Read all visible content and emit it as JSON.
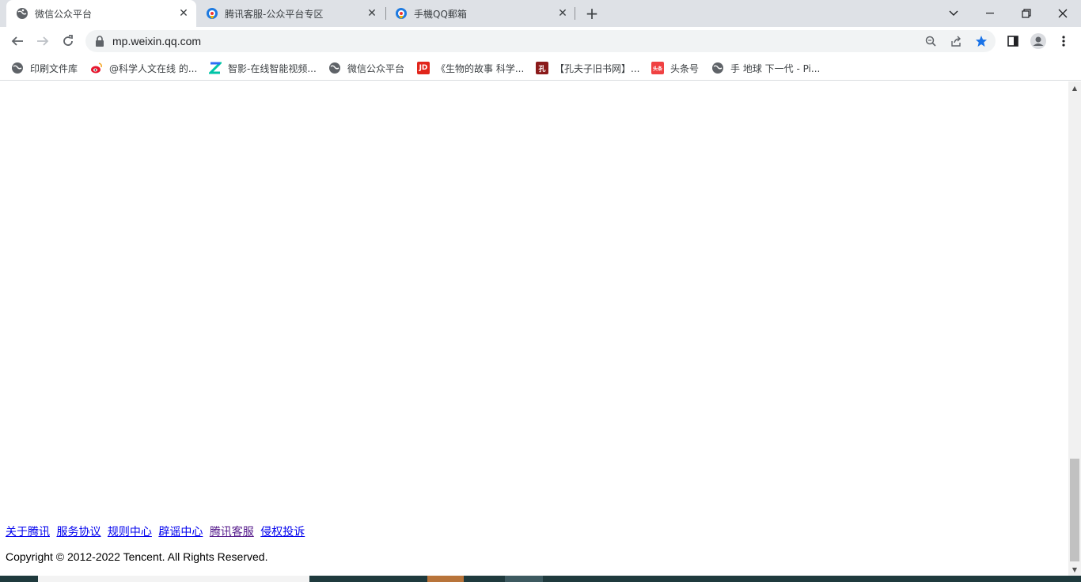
{
  "browser": {
    "tabs": [
      {
        "title": "微信公众平台",
        "favicon": "globe-icon",
        "active": true
      },
      {
        "title": "腾讯客服-公众平台专区",
        "favicon": "tencent-cs-icon",
        "active": false
      },
      {
        "title": "手機QQ郵箱",
        "favicon": "tencent-cs-icon",
        "active": false
      }
    ],
    "new_tab": "+",
    "window_controls": {
      "tab_search": "⌄",
      "minimize": "—",
      "restore": "❐",
      "close": "✕"
    },
    "nav": {
      "back": "←",
      "forward": "→",
      "reload": "↻"
    },
    "url": "mp.weixin.qq.com",
    "omnibox_icons": {
      "zoom": "🔍",
      "share": "⇪",
      "bookmark_star": "★"
    },
    "toolbar_icons": {
      "side_panel": "▯",
      "profile": "●",
      "menu": "⋮"
    },
    "bookmarks": [
      {
        "label": "印刷文件库",
        "icon": "globe-icon"
      },
      {
        "label": "@科学人文在线 的...",
        "icon": "weibo-icon"
      },
      {
        "label": "智影-在线智能视频...",
        "icon": "zhiying-icon"
      },
      {
        "label": "微信公众平台",
        "icon": "globe-icon"
      },
      {
        "label": "《生物的故事 科学...",
        "icon": "jd-icon",
        "icon_text": "JD"
      },
      {
        "label": "【孔夫子旧书网】...",
        "icon": "kongfz-icon",
        "icon_text": "孔"
      },
      {
        "label": "头条号",
        "icon": "toutiao-icon",
        "icon_text": "头条"
      },
      {
        "label": "手 地球 下一代 - Pi...",
        "icon": "globe-icon"
      }
    ]
  },
  "page": {
    "footer_links": [
      "关于腾讯",
      "服务协议",
      "规则中心",
      "辟谣中心",
      "腾讯客服",
      "侵权投诉"
    ],
    "copyright": "Copyright © 2012-2022 Tencent. All Rights Reserved."
  },
  "colors": {
    "tabstrip_bg": "#dee1e6",
    "link": "#0000ee",
    "link_visited": "#551a8b",
    "star_blue": "#1a73e8"
  }
}
